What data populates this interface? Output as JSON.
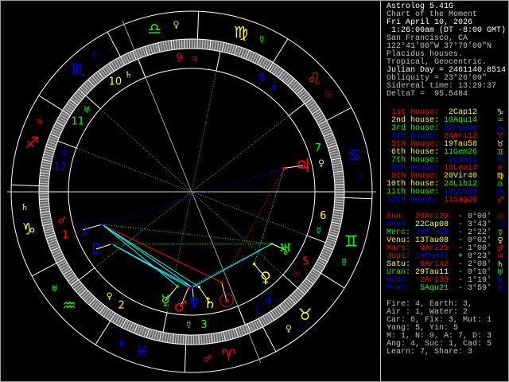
{
  "header": {
    "lines": [
      {
        "text": "Astrolog 5.41G",
        "color": "#ffffff"
      },
      {
        "text": "Chart of the Moment",
        "color": "#c0c0c0"
      },
      {
        "text": "Fri April 10, 2026",
        "color": "#ffffff"
      },
      {
        "text": " 1:26:00am (DT -8:00 GMT)",
        "color": "#ffffff"
      },
      {
        "text": "San Francisco, CA",
        "color": "#c0c0c0"
      },
      {
        "text": "122°41'00\"W 37°79'00\"N",
        "color": "#c0c0c0"
      },
      {
        "text": "Placidus houses.",
        "color": "#c0c0c0"
      },
      {
        "text": "Tropical, Geocentric.",
        "color": "#c0c0c0"
      },
      {
        "text": "Julian Day = 2461140.8514",
        "color": "#ffffff"
      },
      {
        "text": "Obliquity = 23°26'09\"",
        "color": "#c0c0c0"
      },
      {
        "text": "Sidereal time: 13:29:37",
        "color": "#c0c0c0"
      },
      {
        "text": "DeltaT =  95.5484",
        "color": "#c0c0c0"
      }
    ]
  },
  "ascendant_longitude": 272.2,
  "midheaven_longitude": 204.2,
  "houses": [
    {
      "label": "1st house:",
      "cusp": "2Cap12",
      "lon": 272.2,
      "glyph": "♑",
      "num": "1",
      "label_color": "#ff0000",
      "cusp_color": "#ffff00",
      "ruler": "♂",
      "ruler_color": "#ff0000"
    },
    {
      "label": "2nd house:",
      "cusp": "10Aqu14",
      "lon": 310.23,
      "glyph": "♒",
      "num": "2",
      "label_color": "#ffff00",
      "cusp_color": "#00ff00",
      "ruler": "♀",
      "ruler_color": "#ffff00"
    },
    {
      "label": "3rd house:",
      "cusp": "20Pis40",
      "lon": 350.67,
      "glyph": "♓",
      "num": "3",
      "label_color": "#00ff00",
      "cusp_color": "#0000ff",
      "ruler": "☿",
      "ruler_color": "#00ff00"
    },
    {
      "label": "4th house:",
      "cusp": "24Ari12",
      "lon": 24.2,
      "glyph": "♈",
      "num": "4",
      "label_color": "#0000ff",
      "cusp_color": "#ff0000",
      "ruler": "☽",
      "ruler_color": "#0000ff"
    },
    {
      "label": "5th house:",
      "cusp": "19Tau58",
      "lon": 49.97,
      "glyph": "♉",
      "num": "5",
      "label_color": "#ff0000",
      "cusp_color": "#ffff00",
      "ruler": "☉",
      "ruler_color": "#ff0000"
    },
    {
      "label": "6th house:",
      "cusp": "11Gem26",
      "lon": 71.43,
      "glyph": "♊",
      "num": "6",
      "label_color": "#ffff00",
      "cusp_color": "#00ff00",
      "ruler": "☿",
      "ruler_color": "#00ff00"
    },
    {
      "label": "7th house:",
      "cusp": "2Can12",
      "lon": 92.2,
      "glyph": "♋",
      "num": "7",
      "label_color": "#00ff00",
      "cusp_color": "#0000ff",
      "ruler": "♀",
      "ruler_color": "#ffff00"
    },
    {
      "label": "8th house:",
      "cusp": "10Leo14",
      "lon": 130.23,
      "glyph": "♌",
      "num": "8",
      "label_color": "#0000ff",
      "cusp_color": "#ff0000",
      "ruler": "♆",
      "ruler_color": "#0000ff"
    },
    {
      "label": "9th house:",
      "cusp": "20Vir40",
      "lon": 170.67,
      "glyph": "♍",
      "num": "9",
      "label_color": "#ff0000",
      "cusp_color": "#ffff00",
      "ruler": "♃",
      "ruler_color": "#ff0000"
    },
    {
      "label": "10th house:",
      "cusp": "24Lib12",
      "lon": 204.2,
      "glyph": "♎",
      "num": "10",
      "label_color": "#ffff00",
      "cusp_color": "#00ff00",
      "ruler": "♄",
      "ruler_color": "#ffff00"
    },
    {
      "label": "11th house:",
      "cusp": "19Sco58",
      "lon": 229.97,
      "glyph": "♏",
      "num": "11",
      "label_color": "#00ff00",
      "cusp_color": "#0000ff",
      "ruler": "♅",
      "ruler_color": "#00ff00"
    },
    {
      "label": "12th house:",
      "cusp": "11Sag26",
      "lon": 251.43,
      "glyph": "♐",
      "num": "12",
      "label_color": "#0000ff",
      "cusp_color": "#ff0000",
      "ruler": "♆",
      "ruler_color": "#0000ff"
    }
  ],
  "signs": [
    {
      "name": "aries",
      "glyph": "♈",
      "color": "#ff0000",
      "ruler": "♂",
      "ruler_color": "#ff0000"
    },
    {
      "name": "taurus",
      "glyph": "♉",
      "color": "#ffff00",
      "ruler": "♀",
      "ruler_color": "#ffff00"
    },
    {
      "name": "gemini",
      "glyph": "♊",
      "color": "#00ff00",
      "ruler": "☿",
      "ruler_color": "#00ff00"
    },
    {
      "name": "cancer",
      "glyph": "♋",
      "color": "#0000ff",
      "ruler": "☽",
      "ruler_color": "#0000ff"
    },
    {
      "name": "leo",
      "glyph": "♌",
      "color": "#ff0000",
      "ruler": "☉",
      "ruler_color": "#ff0000"
    },
    {
      "name": "virgo",
      "glyph": "♍",
      "color": "#ffff00",
      "ruler": "☿",
      "ruler_color": "#00ff00"
    },
    {
      "name": "libra",
      "glyph": "♎",
      "color": "#00ff00",
      "ruler": "♀",
      "ruler_color": "#ffff00"
    },
    {
      "name": "scorpio",
      "glyph": "♏",
      "color": "#0000ff",
      "ruler": "♇",
      "ruler_color": "#0000ff"
    },
    {
      "name": "sagittarius",
      "glyph": "♐",
      "color": "#ff0000",
      "ruler": "♃",
      "ruler_color": "#ff0000"
    },
    {
      "name": "capricorn",
      "glyph": "♑",
      "color": "#ffff00",
      "ruler": "♄",
      "ruler_color": "#ffff00"
    },
    {
      "name": "aquarius",
      "glyph": "♒",
      "color": "#00ff00",
      "ruler": "♅",
      "ruler_color": "#00ff00"
    },
    {
      "name": "pisces",
      "glyph": "♓",
      "color": "#0000ff",
      "ruler": "♆",
      "ruler_color": "#0000ff"
    }
  ],
  "planets": [
    {
      "name": "Sun:",
      "id": "sun",
      "pos": "20Ari29",
      "lon": 20.48,
      "motion": "- 0°00'",
      "glyph": "☉",
      "color": "#ff0000",
      "pos_color": "#ff0000"
    },
    {
      "name": "Moon:",
      "id": "moon",
      "pos": "22Cap08",
      "lon": 292.13,
      "motion": "- 3°43'",
      "glyph": "☽",
      "color": "#0000ff",
      "pos_color": "#ffff00"
    },
    {
      "name": "Merc:",
      "id": "mercury",
      "pos": "23Pis38",
      "lon": 353.63,
      "motion": "- 2°22'",
      "glyph": "☿",
      "color": "#00ff00",
      "pos_color": "#0000ff"
    },
    {
      "name": "Venu:",
      "id": "venus",
      "pos": "13Tau08",
      "lon": 43.13,
      "motion": "- 0°02'",
      "glyph": "♀",
      "color": "#ffff00",
      "pos_color": "#ffff00"
    },
    {
      "name": "Mars:",
      "id": "mars",
      "pos": "0Ari25",
      "lon": 0.42,
      "motion": "- 1°00'",
      "glyph": "♂",
      "color": "#ff0000",
      "pos_color": "#ff0000"
    },
    {
      "name": "Jupi:",
      "id": "jupiter",
      "pos": "16Can31",
      "lon": 106.52,
      "motion": "+ 0°23'",
      "glyph": "♃",
      "color": "#ff0000",
      "pos_color": "#0000ff"
    },
    {
      "name": "Satu:",
      "id": "saturn",
      "pos": "6Ari42",
      "lon": 6.7,
      "motion": "- 2°08'",
      "glyph": "♄",
      "color": "#ffff00",
      "pos_color": "#ff0000"
    },
    {
      "name": "Uran:",
      "id": "uranus",
      "pos": "29Tau11",
      "lon": 59.18,
      "motion": "- 0°10'",
      "glyph": "♅",
      "color": "#00ff00",
      "pos_color": "#ffff00"
    },
    {
      "name": "Nept:",
      "id": "neptune",
      "pos": "2Ari33",
      "lon": 2.55,
      "motion": "- 1°19'",
      "glyph": "♆",
      "color": "#0000ff",
      "pos_color": "#ff0000"
    },
    {
      "name": "Plut:",
      "id": "pluto",
      "pos": "5Aqu21",
      "lon": 305.35,
      "motion": "- 3°59'",
      "glyph": "♇",
      "color": "#0000ff",
      "pos_color": "#00ff00"
    }
  ],
  "aspects": [
    {
      "a": 1,
      "b": 5,
      "color": "#0000ff",
      "style": "dotted"
    },
    {
      "a": 1,
      "b": 0,
      "color": "#ff0000",
      "style": "solid"
    },
    {
      "a": 0,
      "b": 5,
      "color": "#ff0000",
      "style": "dotted"
    },
    {
      "a": 1,
      "b": 7,
      "color": "#00ff00",
      "style": "dotted"
    },
    {
      "a": 9,
      "b": 7,
      "color": "#00ff00",
      "style": "dotted"
    },
    {
      "a": 1,
      "b": 2,
      "color": "#00ffff",
      "style": "solid"
    },
    {
      "a": 1,
      "b": 8,
      "color": "#00ffff",
      "style": "solid"
    },
    {
      "a": 1,
      "b": 6,
      "color": "#00ffff",
      "style": "solid"
    },
    {
      "a": 9,
      "b": 4,
      "color": "#00ffff",
      "style": "solid"
    },
    {
      "a": 9,
      "b": 8,
      "color": "#00ffff",
      "style": "solid"
    },
    {
      "a": 7,
      "b": 8,
      "color": "#00ffff",
      "style": "solid"
    },
    {
      "a": 7,
      "b": 4,
      "color": "#00ffff",
      "style": "dotted"
    },
    {
      "a": 3,
      "b": 5,
      "color": "#00ffff",
      "style": "dotted"
    },
    {
      "a": 4,
      "b": 8,
      "color": "#ffff00",
      "style": "dotted"
    },
    {
      "a": 4,
      "b": 6,
      "color": "#ffff00",
      "style": "dotted"
    }
  ],
  "elements": [
    "Fire: 4, Earth: 3,",
    "Air : 1, Water: 2",
    "Car: 6, Fix: 3, Mut: 1",
    "Yang: 5, Yin: 5",
    "M: 1, N: 9, A: 7, D: 3",
    "Ang: 4, Suc: 1, Cad: 5",
    "Learn: 7, Share: 3"
  ]
}
